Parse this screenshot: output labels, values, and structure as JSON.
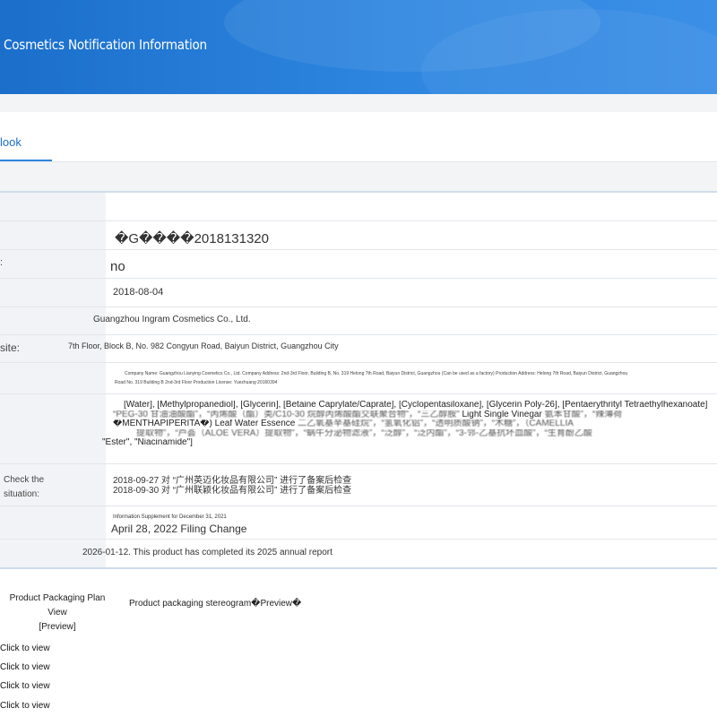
{
  "banner": {
    "title": "Cosmetics Notification Information"
  },
  "tab": {
    "label": "look"
  },
  "table": {
    "rows": [
      {
        "label": "",
        "value": ""
      },
      {
        "label": "",
        "value": "�G����2018131320"
      },
      {
        "label": ":",
        "value": "no"
      },
      {
        "label": "",
        "value": "2018-08-04"
      },
      {
        "label": "",
        "value": "Guangzhou Ingram Cosmetics Co., Ltd."
      },
      {
        "label": "site:",
        "value": "7th Floor, Block B, No. 982 Congyun Road, Baiyun District, Guangzhou City"
      },
      {
        "label": "",
        "value_line1": "Company Name: Guangzhou Lianying Cosmetics Co., Ltd. Company Address: 2nd-3rd Floor, Building B, No. 319 Helong 7th Road, Baiyun District, Guangzhou (Can be used as a factory) Production Address: Helong 7th Road, Baiyun District, Guangzhou",
        "value_line2": "Road No. 319 Building B 2nd-3rd Floor Production License: Yuezhuang 20160394"
      },
      {
        "label": "",
        "ingredients": {
          "line1": "[Water], [Methylpropanediol], [Glycerin], [Betaine Caprylate/Caprate], [Cyclopentasiloxane], [Glycerin Poly-26], [Pentaerythrityl Tetraethylhexanoate]",
          "line2_blur": "“PEG-30 甘油油酸酯”，“丙烯酸（酯）类/C10-30 烷醇丙烯酸酯交联聚合物”，“三乙醇胺”",
          "line2_clear": "Light Single Vinegar",
          "line2_tail": "氨苯甘酸”，“辣薄荷",
          "line3_clear": "�MENTHAPIPERITA�) Leaf Water Essence",
          "line3_blur": "二乙氧基辛基硅烷”，“氢氧化铝”，“透明质酸钠”，“木糖”，（CAMELLIA",
          "line4_blur": "提取物”，“芦荟（ALOE VERA）提取物”，“蜗牛分泌物滤液”，“泛醇”，“泛内酯”，“3-邻-乙基抗坏血酸”，“生育酚乙酸",
          "line5": "\"Ester\", \"Niacinamide\"]"
        }
      },
      {
        "label": "Check the situation:",
        "value_line1": "2018-09-27 对 “广州英迈化妆品有限公司” 进行了备案后检查",
        "value_line2": "2018-09-30 对 “广州联颖化妆品有限公司” 进行了备案后检查"
      },
      {
        "label": "",
        "value_small": "Information Supplement for December 31, 2021",
        "value_big": "April 28, 2022 Filing Change"
      },
      {
        "label": "",
        "value": "2026-01-12. This product has completed its 2025 annual report"
      }
    ]
  },
  "packaging": {
    "plan_view": "Product Packaging Plan View",
    "plan_preview": "[Preview]",
    "stereogram": "Product packaging stereogram�Preview�",
    "links": [
      "Click to view",
      "Click to view",
      "Click to view",
      "Click to view"
    ]
  }
}
